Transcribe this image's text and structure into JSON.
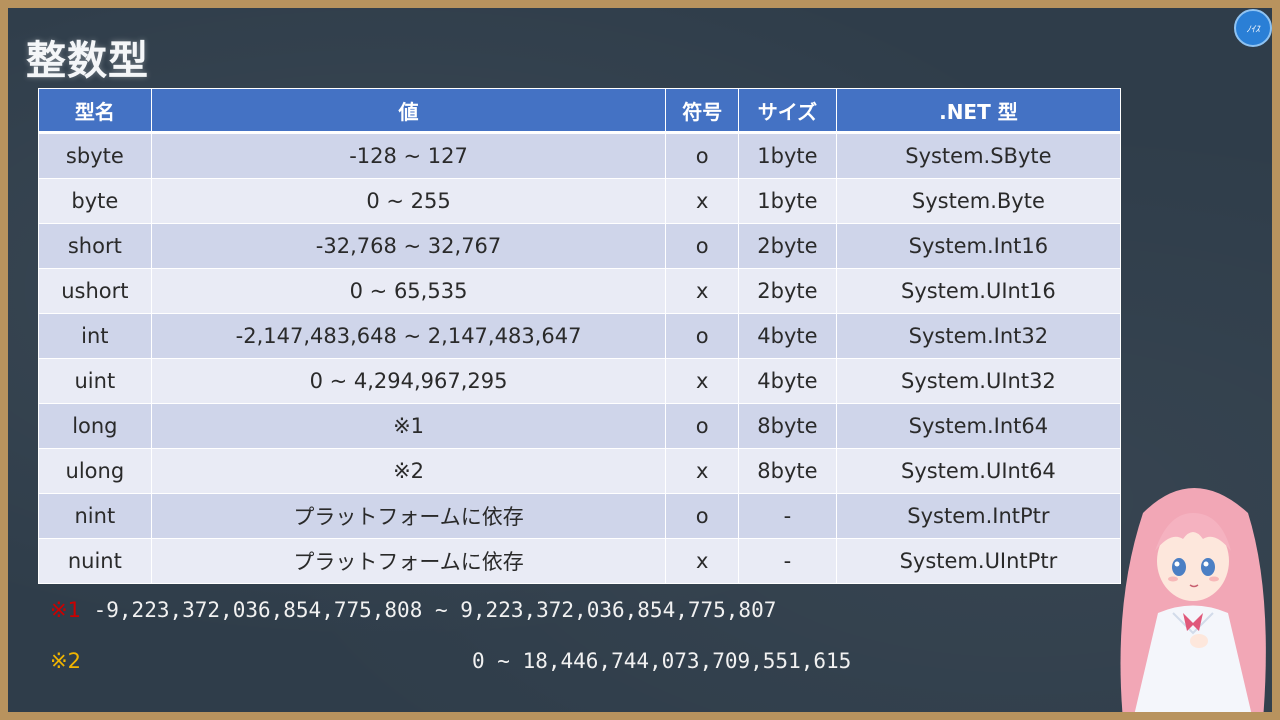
{
  "title": "整数型",
  "logo_text": "ﾉｲｽ",
  "table": {
    "headers": [
      "型名",
      "値",
      "符号",
      "サイズ",
      ".NET 型"
    ],
    "rows": [
      {
        "name": "sbyte",
        "value": "-128 ~ 127",
        "sign": "o",
        "size": "1byte",
        "net": "System.SByte"
      },
      {
        "name": "byte",
        "value": "0 ~ 255",
        "sign": "x",
        "size": "1byte",
        "net": "System.Byte"
      },
      {
        "name": "short",
        "value": "-32,768 ~ 32,767",
        "sign": "o",
        "size": "2byte",
        "net": "System.Int16"
      },
      {
        "name": "ushort",
        "value": "0 ~ 65,535",
        "sign": "x",
        "size": "2byte",
        "net": "System.UInt16"
      },
      {
        "name": "int",
        "value": "-2,147,483,648 ~ 2,147,483,647",
        "sign": "o",
        "size": "4byte",
        "net": "System.Int32"
      },
      {
        "name": "uint",
        "value": "0 ~ 4,294,967,295",
        "sign": "x",
        "size": "4byte",
        "net": "System.UInt32"
      },
      {
        "name": "long",
        "value": "※1",
        "sign": "o",
        "size": "8byte",
        "net": "System.Int64"
      },
      {
        "name": "ulong",
        "value": "※2",
        "sign": "x",
        "size": "8byte",
        "net": "System.UInt64"
      },
      {
        "name": "nint",
        "value": "プラットフォームに依存",
        "sign": "o",
        "size": "-",
        "net": "System.IntPtr"
      },
      {
        "name": "nuint",
        "value": "プラットフォームに依存",
        "sign": "x",
        "size": "-",
        "net": "System.UIntPtr"
      }
    ]
  },
  "footnotes": {
    "note1_mark": "※1",
    "note1_text": "-9,223,372,036,854,775,808 ~ 9,223,372,036,854,775,807",
    "note2_mark": "※2",
    "note2_text": "0 ~ 18,446,744,073,709,551,615"
  },
  "colors": {
    "board": "#2f3d4a",
    "frame": "#b8935e",
    "header": "#4472c4",
    "row_odd": "#cfd5ea",
    "row_even": "#e9ebf5",
    "note1": "#cc0000",
    "note2": "#f0b400"
  }
}
